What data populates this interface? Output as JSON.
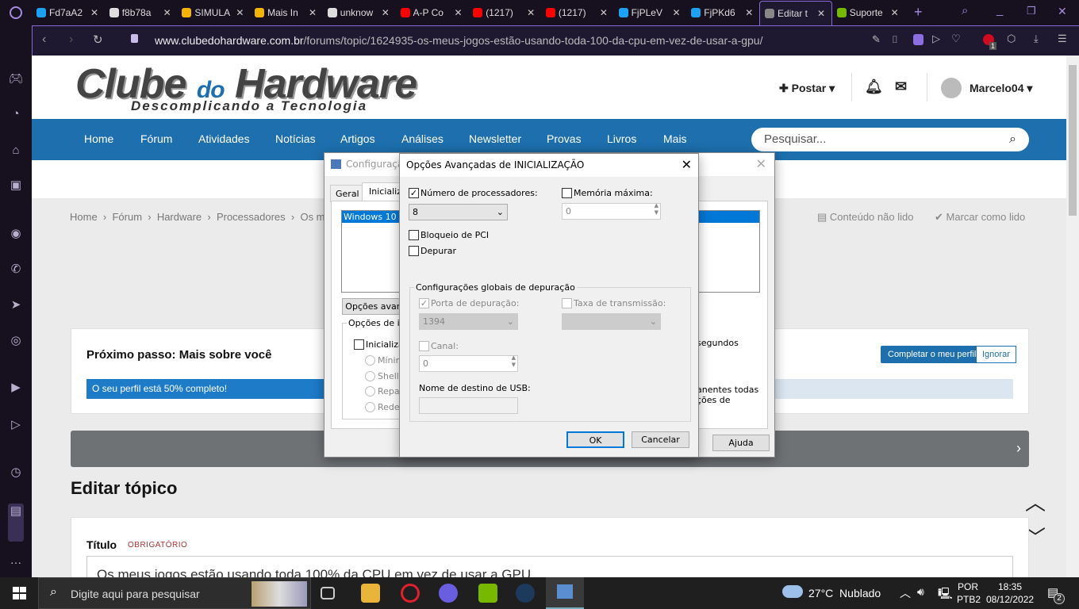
{
  "browser": {
    "tabs": [
      {
        "label": "Fd7aA2",
        "icon": "twitter-icon"
      },
      {
        "label": "f8b78a",
        "icon": "globe-icon"
      },
      {
        "label": "SIMULA",
        "icon": "google-drive-icon"
      },
      {
        "label": "Mais In",
        "icon": "google-drive-icon"
      },
      {
        "label": "unknow",
        "icon": "globe-icon"
      },
      {
        "label": "A-P Co",
        "icon": "youtube-icon"
      },
      {
        "label": "(1217)",
        "icon": "youtube-icon"
      },
      {
        "label": "(1217)",
        "icon": "youtube-icon"
      },
      {
        "label": "FjPLeV",
        "icon": "twitter-icon"
      },
      {
        "label": "FjPKd6",
        "icon": "twitter-icon"
      },
      {
        "label": "Editar t",
        "icon": "site-icon",
        "active": true
      },
      {
        "label": "Suporte",
        "icon": "nvidia-icon"
      }
    ],
    "url_domain": "www.clubedohardware.com.br",
    "url_path": "/forums/topic/1624935-os-meus-jogos-estão-usando-toda-100-da-cpu-em-vez-de-usar-a-gpu/",
    "badge_count": "1"
  },
  "site": {
    "logo": "Clube do Hardware",
    "logo_a": "Clube ",
    "logo_b": "do",
    "logo_c": " Hardware",
    "tagline": "Descomplicando a Tecnologia",
    "post": "Postar",
    "user": "Marcelo04",
    "nav": [
      "Home",
      "Fórum",
      "Atividades",
      "Notícias",
      "Artigos",
      "Análises",
      "Newsletter",
      "Provas",
      "Livros",
      "Mais"
    ],
    "search_placeholder": "Pesquisar...",
    "breadcrumb": [
      "Home",
      "Fórum",
      "Hardware",
      "Processadores",
      "Os me"
    ],
    "unread": "Conteúdo não lido",
    "mark_read": "Marcar como lido",
    "next_step": "Próximo passo: Mais sobre você",
    "complete_profile": "Completar o meu perfil",
    "ignore": "Ignorar",
    "progress_text": "O seu perfil está 50% completo!",
    "progress": 0.5,
    "edit_title": "Editar tópico",
    "title_label": "Título",
    "required": "OBRIGATÓRIO",
    "title_value": "Os meus jogos estão usando toda 100% da CPU em vez de usar a GPU",
    "accent": "#1d6fad"
  },
  "msconfig": {
    "title": "Configuração do Sistema",
    "title_cut": "Configuraçã",
    "tabs": [
      "Geral",
      "Inicializa"
    ],
    "os_item": "Windows 10 (C",
    "adv_button": "Opções avan",
    "boot_opts": "Opções de inic",
    "safe_boot": "Inicializaç",
    "radios": [
      "Mínima",
      "Shell a",
      "Repar",
      "Rede"
    ],
    "seconds": "segundos",
    "perm1": "anentes todas",
    "perm2": "ções de",
    "help": "Ajuda"
  },
  "advanced": {
    "title": "Opções Avançadas de INICIALIZAÇÃO",
    "num_proc_label": "Número de processadores:",
    "num_proc_checked": true,
    "num_proc_value": "8",
    "max_mem_label": "Memória máxima:",
    "max_mem_value": "0",
    "pci_lock": "Bloqueio de PCI",
    "debug": "Depurar",
    "global_debug": "Configurações globais de depuração",
    "debug_port": "Porta de depuração:",
    "debug_port_value": "1394",
    "baud_rate": "Taxa de transmissão:",
    "channel": "Canal:",
    "channel_value": "0",
    "usb_target": "Nome de destino de USB:",
    "ok": "OK",
    "cancel": "Cancelar"
  },
  "taskbar": {
    "search_placeholder": "Digite aqui para pesquisar",
    "weather": "27°C  Nublado",
    "lang1": "POR",
    "lang2": "PTB2",
    "time": "18:35",
    "date": "08/12/2022",
    "notifications": "2"
  }
}
